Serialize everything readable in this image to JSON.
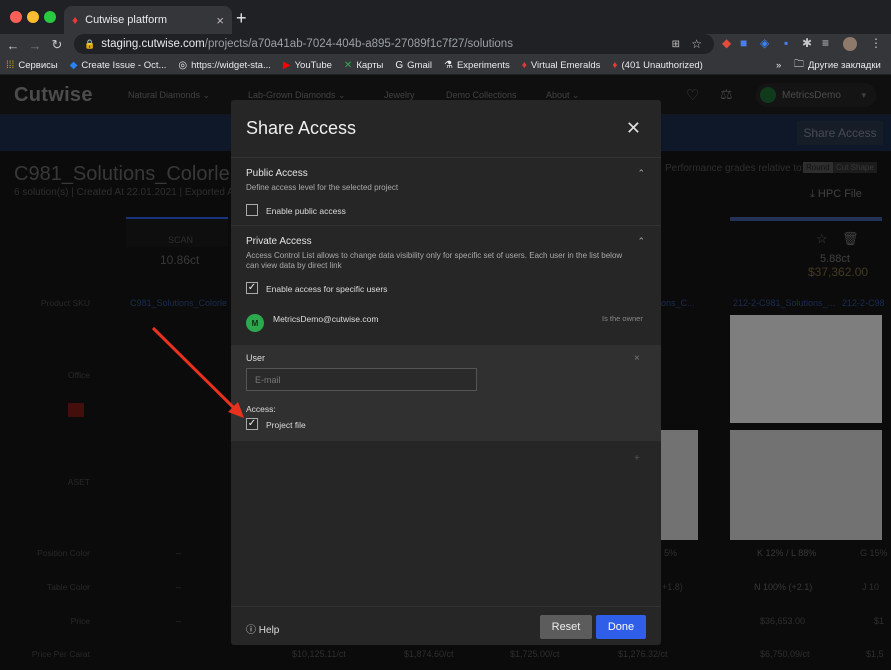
{
  "browser": {
    "tab_title": "Cutwise platform",
    "url_host": "staging.cutwise.com",
    "url_path": "/projects/a70a41ab-7024-404b-a895-27089f1c7f27/solutions",
    "bookmarks": [
      "Сервисы",
      "Create Issue - Oct...",
      "https://widget-sta...",
      "YouTube",
      "Карты",
      "Gmail",
      "Experiments",
      "Virtual Emeralds",
      "(401 Unauthorized)"
    ],
    "bookmarks_more": "»",
    "other_bookmarks": "Другие закладки"
  },
  "app": {
    "logo": "Cutwise",
    "nav": [
      "Natural Diamonds",
      "Lab-Grown Diamonds",
      "Jewelry",
      "Demo Collections",
      "About"
    ],
    "user": "MetricsDemo",
    "share_access_button": "Share Access",
    "project_title": "C981_Solutions_Colorle",
    "project_meta": "6 solution(s) | Created At 22.01.2021 | Exported A",
    "grades_label": "Performance grades relative to:",
    "grade_round": "Round",
    "grade_cut_shape": "Cut Shape",
    "hpc_file": "HPC File",
    "scan_label": "SCAN",
    "scan_weight": "10.86ct",
    "right_weight": "5.88ct",
    "right_price": "$37,362.00",
    "row_labels": [
      "Product SKU",
      "Office",
      "ASET",
      "Position Color",
      "Table Color",
      "Price",
      "Price Per Carat"
    ],
    "sku_left": "C981_Solutions_Colorle",
    "sku_right_1": "212-2-C981_Solutions_...",
    "sku_right_2": "212-2-C98",
    "sku_mid": "ons_C...",
    "position_color_vals": [
      "5%",
      "K 12% / L 88%",
      "G 15%"
    ],
    "table_color_vals": [
      "+1.8)",
      "N 100% (+2.1)",
      "J 10"
    ],
    "price_vals": [
      "$36,653.00",
      "$1"
    ],
    "price_per_carat_vals": [
      "$10,125.11/ct",
      "$1,874.60/ct",
      "$1,725.00/ct",
      "$1,276.32/ct",
      "$6,750.09/ct",
      "$1,5"
    ],
    "dash": "–"
  },
  "modal": {
    "title": "Share Access",
    "public": {
      "heading": "Public Access",
      "description": "Define access level for the selected project",
      "checkbox_label": "Enable public access",
      "checked": false
    },
    "private": {
      "heading": "Private Access",
      "description": "Access Control List allows to change data visibility only for specific set of users. Each user in the list below can view data by direct link",
      "checkbox_label": "Enable access for specific users",
      "checked": true,
      "owner_initial": "M",
      "owner_email": "MetricsDemo@cutwise.com",
      "owner_role": "Is the owner"
    },
    "new_user": {
      "label": "User",
      "email_placeholder": "E-mail",
      "access_label": "Access:",
      "project_file_label": "Project file",
      "project_file_checked": true
    },
    "help": "Help",
    "reset": "Reset",
    "done": "Done"
  },
  "colors": {
    "primary": "#2f5ee8",
    "arrow": "#e8321f",
    "avatar": "#2ea84f"
  }
}
